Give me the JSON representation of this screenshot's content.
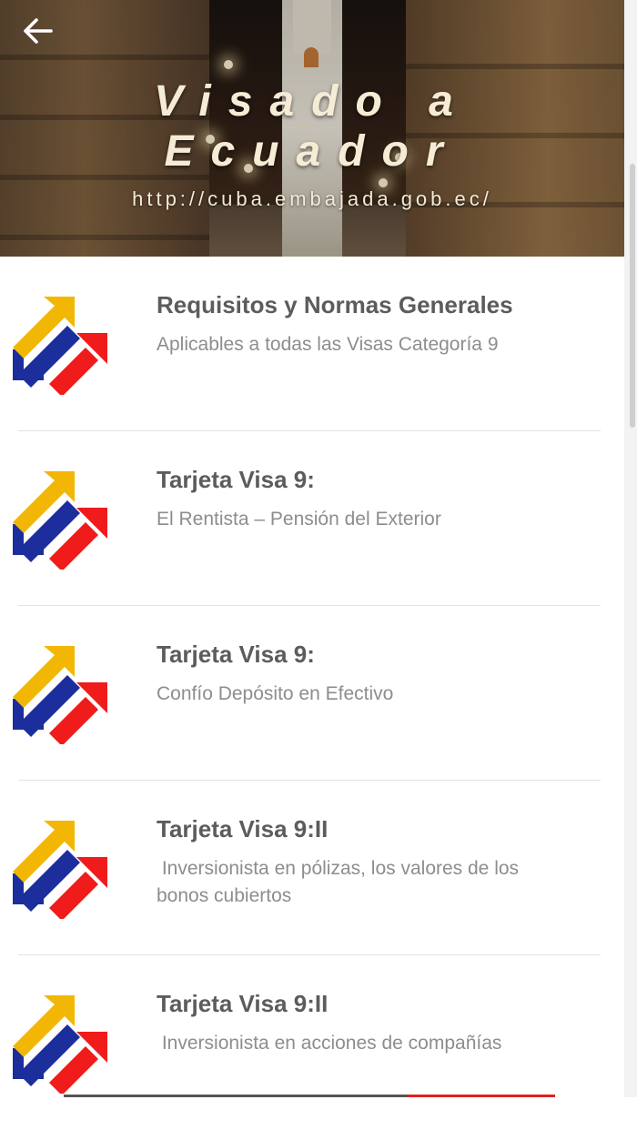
{
  "header": {
    "title": "Visado a Ecuador",
    "url": "http://cuba.embajada.gob.ec/"
  },
  "colors": {
    "logo_yellow": "#F2B705",
    "logo_blue": "#1C2E9C",
    "logo_red": "#F01B1B",
    "title_text": "#5C5C5C",
    "subtitle_text": "#8D8D8D"
  },
  "items": [
    {
      "title": "Requisitos y Normas Generales",
      "subtitle": "Aplicables a todas las Visas Categoría 9"
    },
    {
      "title": "Tarjeta Visa 9:",
      "subtitle": "El Rentista – Pensión del Exterior"
    },
    {
      "title": "Tarjeta Visa 9:",
      "subtitle": "Confío Depósito en Efectivo"
    },
    {
      "title": "Tarjeta Visa 9:II",
      "subtitle": " Inversionista en pólizas, los valores de los bonos cubiertos"
    },
    {
      "title": "Tarjeta Visa 9:II",
      "subtitle": " Inversionista en acciones de compañías"
    }
  ]
}
